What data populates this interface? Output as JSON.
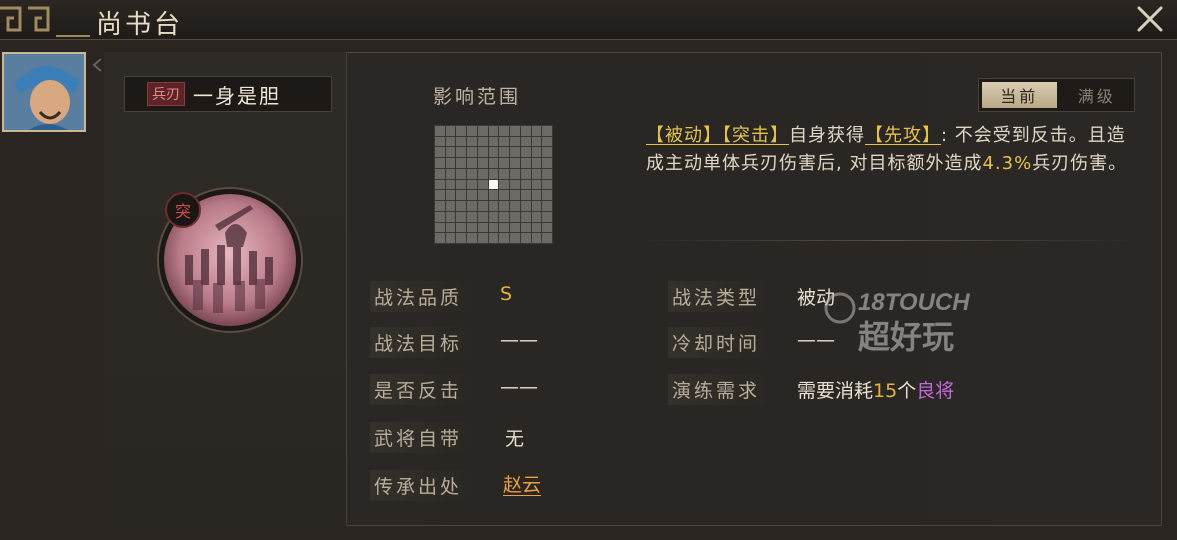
{
  "header": {
    "title": "尚书台",
    "close_icon": "close-icon"
  },
  "skill": {
    "tag": "兵刃",
    "name": "一身是胆",
    "badge": "突"
  },
  "range": {
    "label": "影响范围",
    "grid_size": 11,
    "center_index": 60
  },
  "toggle": {
    "current": "当前",
    "max": "满级"
  },
  "description": {
    "segments": [
      {
        "text": "【被动】",
        "style": "kw"
      },
      {
        "text": "【突击】",
        "style": "kw"
      },
      {
        "text": "自身获得",
        "style": "plain"
      },
      {
        "text": "【先攻】",
        "style": "kw"
      },
      {
        "text": ": 不会受到反击。且造成主动单体兵刃伤害后, 对目标额外造成",
        "style": "plain"
      },
      {
        "text": "4.3%",
        "style": "pct"
      },
      {
        "text": "兵刃伤害。",
        "style": "plain"
      }
    ]
  },
  "attributes_left": [
    {
      "label": "战法品质",
      "value": "S",
      "style": "gold"
    },
    {
      "label": "战法目标",
      "value": "——",
      "style": "plain"
    },
    {
      "label": "是否反击",
      "value": "——",
      "style": "plain"
    },
    {
      "label": "武将自带",
      "value": "无",
      "style": "plain"
    },
    {
      "label": "传承出处",
      "value": "赵云",
      "style": "link"
    }
  ],
  "attributes_right": [
    {
      "label": "战法类型",
      "value": "被动",
      "style": "plain"
    },
    {
      "label": "冷却时间",
      "value": "——",
      "style": "plain"
    },
    {
      "label": "演练需求",
      "value_prefix": "需要消耗",
      "value_count": "15",
      "value_unit": "个",
      "value_item": "良将"
    }
  ],
  "watermark": {
    "line1": "18TOUCH",
    "line2": "超好玩"
  },
  "colors": {
    "gold": "#e4b53c",
    "purple": "#c06ad8",
    "link": "#e8a040",
    "badge_red": "#d34a4a"
  }
}
